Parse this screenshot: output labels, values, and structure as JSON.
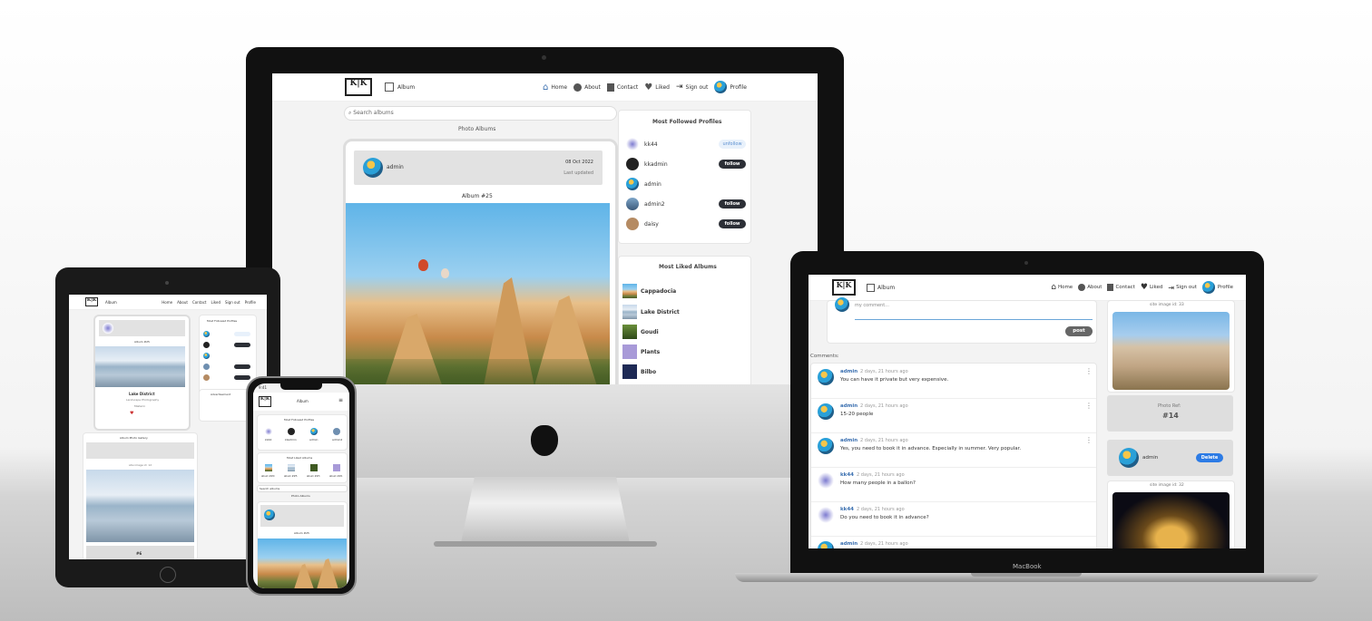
{
  "brand": {
    "logo_mark": "K|K",
    "logo_sub": "KK Images"
  },
  "nav": {
    "album": "Album",
    "home": "Home",
    "about": "About",
    "contact": "Contact",
    "liked": "Liked",
    "sign_out": "Sign out",
    "profile": "Profile"
  },
  "search": {
    "placeholder": "Search albums"
  },
  "albums": {
    "heading": "Photo Albums",
    "card_user": "admin",
    "card_date": "08 Oct 2022",
    "card_updated": "Last updated",
    "card_title": "Album #25"
  },
  "followed": {
    "title": "Most Followed Profiles",
    "items": [
      {
        "name": "kk44",
        "action": "unfollow"
      },
      {
        "name": "kkadmin",
        "action": "follow"
      },
      {
        "name": "admin",
        "action": ""
      },
      {
        "name": "admin2",
        "action": "follow"
      },
      {
        "name": "daisy",
        "action": "follow"
      }
    ]
  },
  "liked_albums": {
    "title": "Most Liked Albums",
    "items": [
      "Cappadocia",
      "Lake District",
      "Goudi",
      "Plants",
      "Bilbo"
    ]
  },
  "laptop": {
    "comment_placeholder": "my comment...",
    "post": "post",
    "comments_label": "Comments:",
    "comments": [
      {
        "user": "admin",
        "time": "2 days, 21 hours ago",
        "text": "You can have it private but very expensive."
      },
      {
        "user": "admin",
        "time": "2 days, 21 hours ago",
        "text": "15-20 people"
      },
      {
        "user": "admin",
        "time": "2 days, 21 hours ago",
        "text": "Yes, you need to book it in advance. Especially in summer. Very popular."
      },
      {
        "user": "kk44",
        "time": "2 days, 21 hours ago",
        "text": "How many people in a ballon?"
      },
      {
        "user": "kk44",
        "time": "2 days, 21 hours ago",
        "text": "Do you need to book it in advance?"
      },
      {
        "user": "admin",
        "time": "2 days, 21 hours ago",
        "text": ""
      }
    ],
    "site_image_1": "site image id: 33",
    "photo_ref_label": "Photo Ref:",
    "photo_ref": "#14",
    "owner": "admin",
    "delete": "Delete",
    "site_image_2": "site image id: 32",
    "brand_name": "MacBook"
  },
  "tablet": {
    "album_title": "Album #25",
    "album_name": "Lake District",
    "album_sub": "Landscape Photography",
    "album_owner": "Mlaterin",
    "gallery": "Album Photo Gallery",
    "image_id": "site image id: 12",
    "photo_ref": "#6",
    "advertisement": "Advertisement"
  },
  "phone": {
    "time": "9:41",
    "followed": "Most Followed Profiles",
    "liked": "Most Liked Albums",
    "albums": "Photo Albums",
    "album_title": "Album #25",
    "profiles": [
      "kk44",
      "kkadmin",
      "admin",
      "admin2"
    ],
    "liked_items": [
      "album ##0",
      "album ##5",
      "album ##3",
      "album ##1"
    ]
  }
}
